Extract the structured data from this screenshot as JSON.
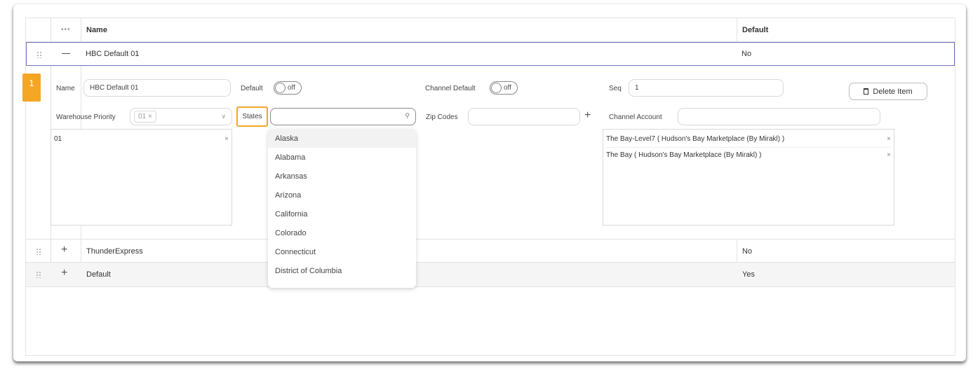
{
  "table": {
    "headers": {
      "more": "•••",
      "name": "Name",
      "default": "Default"
    },
    "rows": [
      {
        "name": "HBC Default 01",
        "default": "No"
      },
      {
        "name": "ThunderExpress",
        "default": "No"
      },
      {
        "name": "Default",
        "default": "Yes"
      }
    ]
  },
  "detail": {
    "index": "1",
    "name_label": "Name",
    "name_value": "HBC Default 01",
    "default_label": "Default",
    "default_toggle": "off",
    "channel_default_label": "Channel Default",
    "channel_default_toggle": "off",
    "seq_label": "Seq",
    "seq_value": "1",
    "delete_label": "Delete Item",
    "warehouse_priority_label": "Warehouse Priority",
    "warehouse_tag": "01 ×",
    "warehouse_list": [
      {
        "text": "01",
        "x": "×"
      }
    ],
    "states_label": "States",
    "states_value": "",
    "zip_codes_label": "Zip Codes",
    "zip_plus": "+",
    "channel_account_label": "Channel Account",
    "channel_account_list": [
      {
        "text": "The Bay-Level7 ( Hudson's Bay Marketplace (By Mirakl) )",
        "x": "×"
      },
      {
        "text": "The Bay ( Hudson's Bay Marketplace (By Mirakl) )",
        "x": "×"
      }
    ]
  },
  "states_dropdown": {
    "options": [
      "Alaska",
      "Alabama",
      "Arkansas",
      "Arizona",
      "California",
      "Colorado",
      "Connecticut",
      "District of Columbia"
    ],
    "highlighted": "Alaska"
  },
  "colors": {
    "accent": "#f5a623",
    "selected_row_border": "#6f73b8"
  },
  "icons": [
    "drag-handle-icon",
    "more-icon",
    "minus-icon",
    "plus-icon",
    "chevron-down-icon",
    "search-icon",
    "trash-icon",
    "close-icon"
  ]
}
